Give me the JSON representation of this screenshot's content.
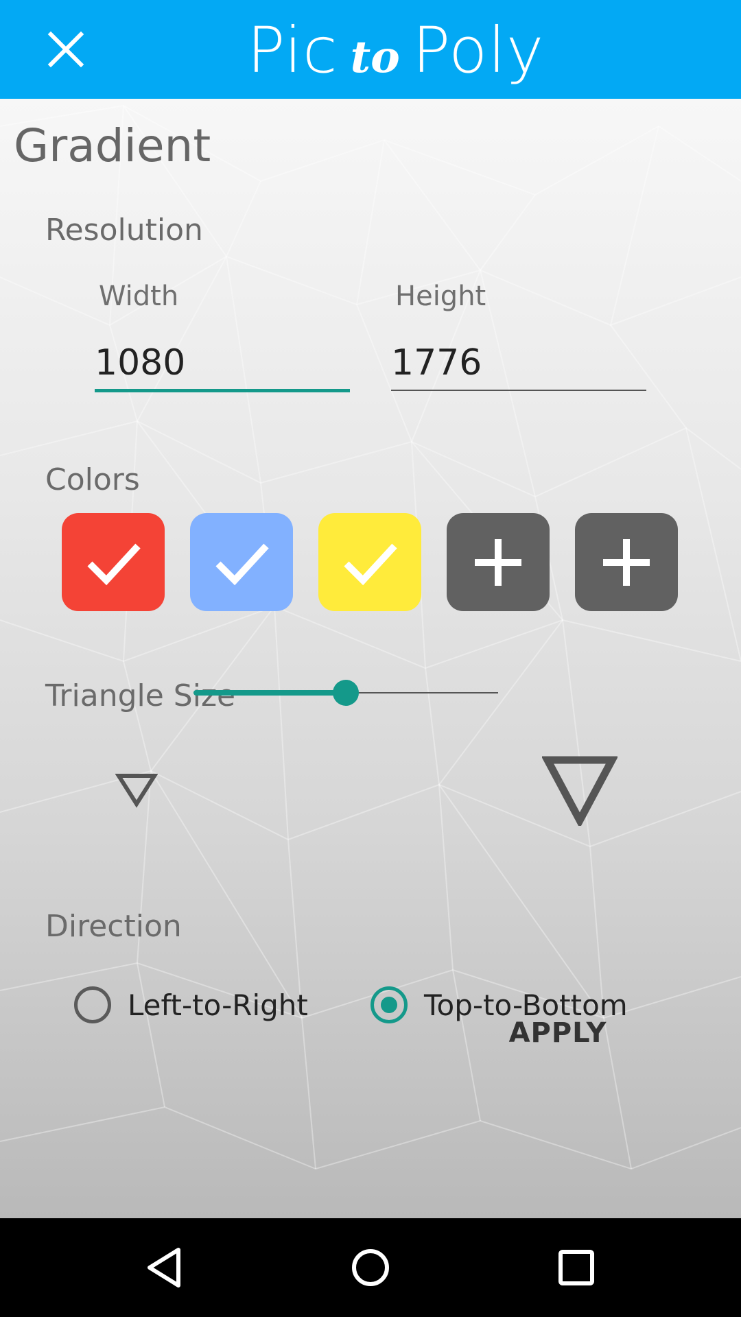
{
  "app_bar": {
    "title_part1": "Pic",
    "title_part2": "to",
    "title_part3": "Poly",
    "color": "#03A9F4",
    "close_icon": "close-icon"
  },
  "main": {
    "section_title": "Gradient",
    "resolution": {
      "label": "Resolution",
      "width_label": "Width",
      "width_value": "1080",
      "height_label": "Height",
      "height_value": "1776"
    },
    "colors": {
      "label": "Colors",
      "swatches": [
        {
          "color": "#F44336",
          "state": "selected",
          "icon": "check-icon"
        },
        {
          "color": "#82B1FF",
          "state": "selected",
          "icon": "check-icon"
        },
        {
          "color": "#FFEB3B",
          "state": "selected",
          "icon": "check-icon"
        },
        {
          "color": "#616161",
          "state": "empty",
          "icon": "plus-icon"
        },
        {
          "color": "#616161",
          "state": "empty",
          "icon": "plus-icon"
        }
      ]
    },
    "triangle_size": {
      "label": "Triangle Size",
      "slider_fraction": 0.5,
      "min_icon": "small-triangle-icon",
      "max_icon": "large-triangle-icon",
      "accent": "#14998A"
    },
    "direction": {
      "label": "Direction",
      "options": [
        {
          "label": "Left-to-Right",
          "selected": false
        },
        {
          "label": "Top-to-Bottom",
          "selected": true
        }
      ]
    },
    "apply_label": "APPLY"
  },
  "nav_bar": {
    "back_icon": "back-triangle-icon",
    "home_icon": "home-circle-icon",
    "recents_icon": "recents-square-icon"
  }
}
